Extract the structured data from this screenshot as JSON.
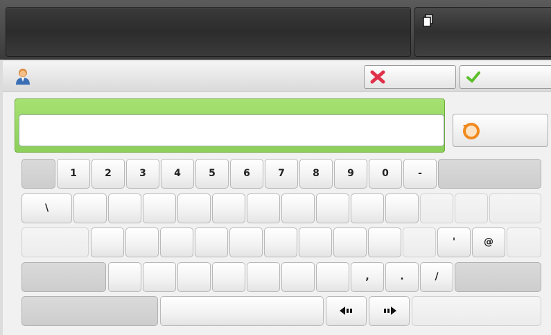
{
  "header": {
    "main_field_text": "",
    "side_icon": "pages-icon"
  },
  "titlebar": {
    "user_icon": "user-icon",
    "cancel_icon": "close-x-icon",
    "ok_icon": "checkmark-icon"
  },
  "input": {
    "value": "",
    "placeholder": ""
  },
  "reset_icon": "undo-arrow-icon",
  "colors": {
    "input_frame": "#8ccf5a",
    "cancel_x": "#e0314a",
    "ok_check": "#5cbf2a",
    "reset_orange": "#f08a1e"
  },
  "keyboard": {
    "row1": [
      "1",
      "2",
      "3",
      "4",
      "5",
      "6",
      "7",
      "8",
      "9",
      "0",
      "-"
    ],
    "row2": [
      "\\"
    ],
    "row3": [
      "'",
      "@"
    ],
    "row4": [
      ",",
      ".",
      "/"
    ],
    "arrows": [
      "arrow-left-icon",
      "arrow-right-icon"
    ]
  }
}
